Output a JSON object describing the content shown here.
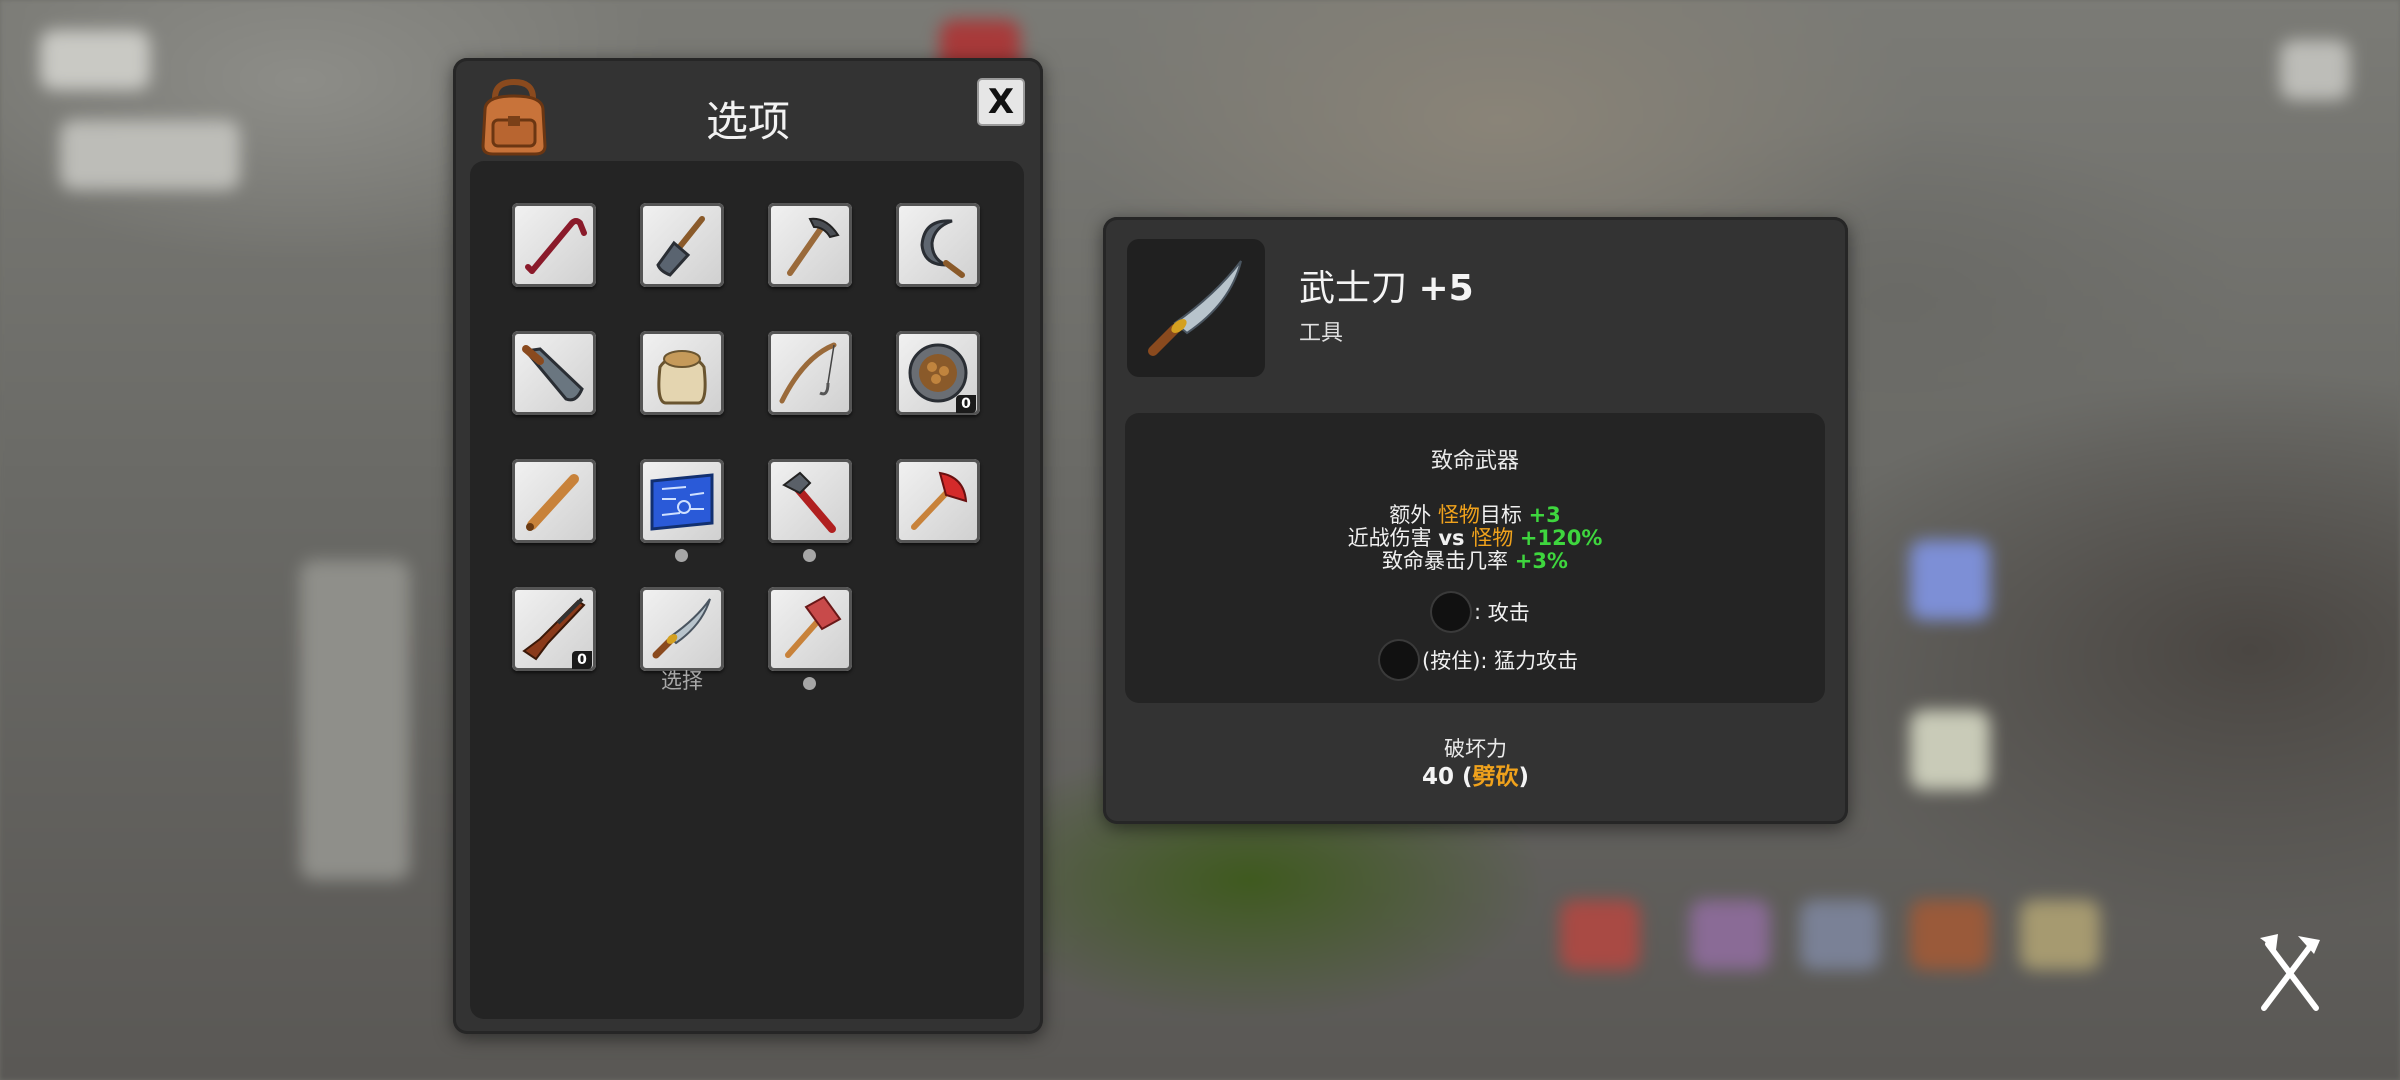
{
  "inventory": {
    "title": "选项",
    "close_label": "X",
    "slots": [
      {
        "icon": "crowbar-icon"
      },
      {
        "icon": "shovel-icon"
      },
      {
        "icon": "pickaxe-icon"
      },
      {
        "icon": "sickle-icon"
      },
      {
        "icon": "machete-icon"
      },
      {
        "icon": "sack-icon"
      },
      {
        "icon": "fishing-rod-icon"
      },
      {
        "icon": "pet-food-bowl-icon",
        "count": "0"
      },
      {
        "icon": "baseball-bat-icon"
      },
      {
        "icon": "blueprint-icon"
      },
      {
        "icon": "pipe-wrench-icon"
      },
      {
        "icon": "fire-axe-icon"
      },
      {
        "icon": "rifle-icon",
        "count": "0"
      },
      {
        "icon": "katana-icon",
        "label": "选择"
      },
      {
        "icon": "sledgehammer-icon"
      }
    ]
  },
  "detail": {
    "name": "武士刀",
    "level": "+5",
    "type": "工具",
    "section_title": "致命武器",
    "stat1": {
      "prefix": "额外",
      "target": "怪物",
      "suffix": "目标",
      "value": "+3"
    },
    "stat2": {
      "prefix": "近战伤害",
      "vs": "vs",
      "target": "怪物",
      "value": "+120%"
    },
    "stat3": {
      "prefix": "致命暴击几率",
      "value": "+3%"
    },
    "control1": {
      "sep": ":",
      "label": "攻击"
    },
    "control2": {
      "prefix": "(按住):",
      "label": "猛力攻击"
    },
    "damage_label": "破坏力",
    "damage_value": "40",
    "damage_type": "劈砍"
  },
  "colors": {
    "highlight": "#f0a21c",
    "bonus": "#3ed63e",
    "panel": "#333333"
  }
}
